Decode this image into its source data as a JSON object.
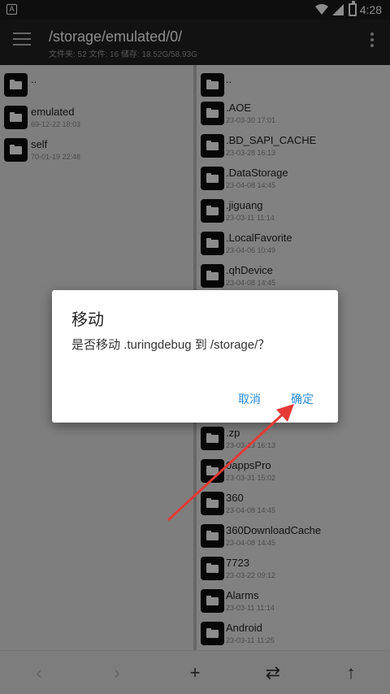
{
  "status_bar": {
    "time": "4:28",
    "app_icon_label": "A"
  },
  "app_bar": {
    "path": "/storage/emulated/0/",
    "stats": "文件夹: 52  文件: 16  储存: 18.52G/58.93G"
  },
  "left_pane": {
    "items": [
      {
        "name": "..",
        "date": ""
      },
      {
        "name": "emulated",
        "date": "69-12-22 18:03"
      },
      {
        "name": "self",
        "date": "70-01-19 22:48"
      }
    ]
  },
  "right_pane": {
    "items": [
      {
        "name": "..",
        "date": ""
      },
      {
        "name": ".AOE",
        "date": "23-03-30 17:01"
      },
      {
        "name": ".BD_SAPI_CACHE",
        "date": "23-03-28 16:13"
      },
      {
        "name": ".DataStorage",
        "date": "23-04-08 14:45"
      },
      {
        "name": ".jiguang",
        "date": "23-03-11 11:14"
      },
      {
        "name": ".LocalFavorite",
        "date": "23-04-06 10:49"
      },
      {
        "name": ".qhDevice",
        "date": "23-04-08 14:45"
      },
      {
        "name": ".zp",
        "date": "23-03-13 16:13"
      },
      {
        "name": "0appsPro",
        "date": "23-03-31 15:02"
      },
      {
        "name": "360",
        "date": "23-04-08 14:45"
      },
      {
        "name": "360DownloadCache",
        "date": "23-04-08 14:45"
      },
      {
        "name": "7723",
        "date": "23-03-22 09:12"
      },
      {
        "name": "Alarms",
        "date": "23-03-11 11:14"
      },
      {
        "name": "Android",
        "date": "23-03-11 11:25"
      }
    ]
  },
  "toolbar": {
    "back": "‹",
    "forward": "›",
    "add": "+",
    "swap": "⇄",
    "up": "↑"
  },
  "dialog": {
    "title": "移动",
    "message": "是否移动 .turingdebug 到 /storage/？",
    "cancel": "取消",
    "ok": "确定"
  },
  "colors": {
    "accent": "#2a8bd5",
    "annotation_arrow": "#e53935"
  }
}
